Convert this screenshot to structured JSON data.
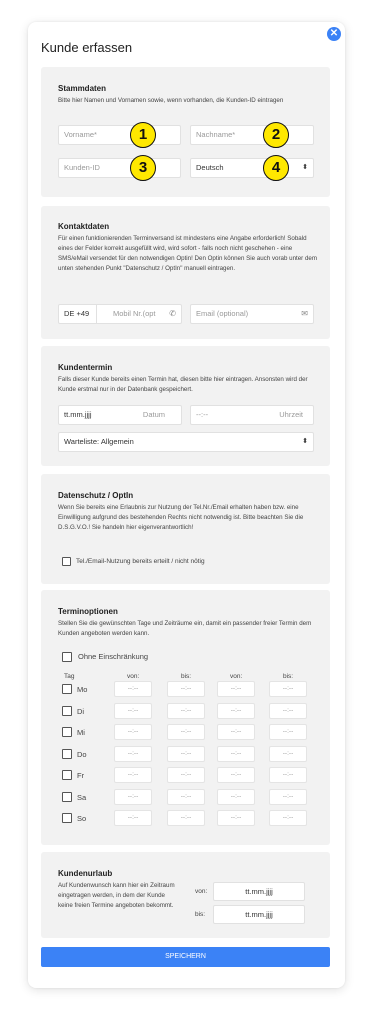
{
  "header": {
    "title": "Kunde erfassen",
    "close": "✕"
  },
  "stammdaten": {
    "title": "Stammdaten",
    "desc": "Bitte hier Namen und Vornamen sowie, wenn vorhanden, die Kunden-ID eintragen",
    "vorname_placeholder": "Vorname*",
    "nachname_placeholder": "Nachname*",
    "kundenid_placeholder": "Kunden-ID",
    "language_value": "Deutsch",
    "badges": [
      "1",
      "2",
      "3",
      "4"
    ]
  },
  "kontakt": {
    "title": "Kontaktdaten",
    "desc": "Für einen funktionierenden Terminversand ist mindestens eine Angabe erforderlich! Sobald eines der Felder korrekt ausgefüllt wird, wird sofort - falls noch nicht geschehen - eine SMS/eMail versendet für den notwendigen Optin! Den Optin können Sie auch vorab unter dem unten stehenden Punkt \"Datenschutz / OptIn\" manuell eintragen.",
    "country_code": "DE +49",
    "mobile_placeholder": "Mobil Nr.(opt",
    "email_placeholder": "Email (optional)"
  },
  "termin": {
    "title": "Kundentermin",
    "desc": "Falls dieser Kunde bereits einen Termin hat, diesen bitte hier eintragen. Ansonsten wird der Kunde erstmal nur in der Datenbank gespeichert.",
    "date_placeholder": "tt.mm.jjjj",
    "date_label": "Datum",
    "time_placeholder": "--:--",
    "time_label": "Uhrzeit",
    "waitlist_value": "Warteliste: Allgemein"
  },
  "datenschutz": {
    "title": "Datenschutz / OptIn",
    "desc": "Wenn Sie bereits eine Erlaubnis zur Nutzung der Tel.Nr./Email erhalten haben bzw. eine Einwilligung aufgrund des bestehenden Rechts nicht notwendig ist. Bitte beachten Sie die D.S.G.V.O.! Sie handeln hier eigenverantwortlich!",
    "checkbox_label": "Tel./Email-Nutzung bereits erteilt / nicht nötig"
  },
  "terminoptionen": {
    "title": "Terminoptionen",
    "desc": "Stellen Sie die gewünschten Tage und Zeiträume ein, damit ein passender freier Termin dem Kunden angeboten werden kann.",
    "no_limit_label": "Ohne Einschränkung",
    "col_tag": "Tag",
    "col_von1": "von:",
    "col_bis1": "bis:",
    "col_von2": "von:",
    "col_bis2": "bis:",
    "time_placeholder": "--:--",
    "days": [
      "Mo",
      "Di",
      "Mi",
      "Do",
      "Fr",
      "Sa",
      "So"
    ]
  },
  "urlaub": {
    "title": "Kundenurlaub",
    "desc": "Auf Kundenwunsch kann hier ein Zeitraum eingetragen werden, in dem der Kunde keine freien Termine angeboten bekommt.",
    "von_label": "von:",
    "bis_label": "bis:",
    "date_placeholder": "tt.mm.jjjj"
  },
  "save_label": "SPEICHERN",
  "colors": {
    "accent": "#3b82f6",
    "badge": "#ffe800",
    "section_bg": "#f2f2f2"
  }
}
